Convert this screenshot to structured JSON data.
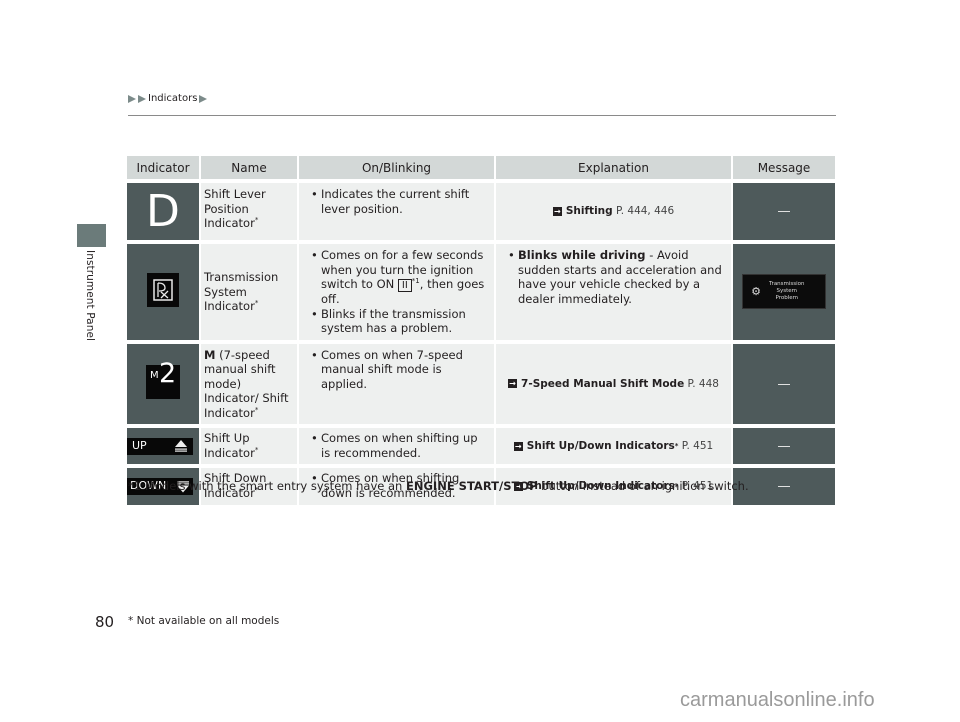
{
  "sidebar": {
    "section_label": "Instrument Panel",
    "tab_color": "#6b7b7a"
  },
  "breadcrumb": {
    "label": "Indicators"
  },
  "table": {
    "headers": [
      "Indicator",
      "Name",
      "On/Blinking",
      "Explanation",
      "Message"
    ],
    "rows": [
      {
        "indicator_icon": "shift-lever-d-icon",
        "indicator_glyph": "D",
        "name": "Shift Lever Position Indicator",
        "name_mark": "*",
        "on_blinking": [
          "Indicates the current shift lever position."
        ],
        "explanation": {
          "ref_title": "Shifting",
          "ref_page": "P. 444, 446"
        },
        "message": "—"
      },
      {
        "indicator_icon": "transmission-system-icon",
        "name": "Transmission System Indicator",
        "name_mark": "*",
        "on_blinking": [
          {
            "pre": "Comes on for a few seconds when you turn the ignition switch to ON ",
            "key": "II",
            "sup": "*1",
            "post": ", then goes off."
          },
          "Blinks if the transmission system has a problem."
        ],
        "explanation": {
          "bold": "Blinks while driving",
          "text": " - Avoid sudden starts and acceleration and have your vehicle checked by a dealer immediately."
        },
        "message": {
          "icon": "warning-gear-icon",
          "lines": [
            "Transmission",
            "System",
            "Problem"
          ]
        }
      },
      {
        "indicator_icon": "manual-mode-m2-icon",
        "indicator_glyph_small": "M",
        "indicator_glyph_big": "2",
        "name_bold": "M",
        "name": " (7-speed manual shift mode) Indicator/ Shift Indicator",
        "name_mark": "*",
        "on_blinking": [
          "Comes on when 7-speed manual shift mode is applied."
        ],
        "explanation": {
          "ref_title": "7-Speed Manual Shift Mode",
          "ref_page": "P. 448"
        },
        "message": "—"
      },
      {
        "indicator_icon": "shift-up-icon",
        "indicator_text": "UP",
        "name": "Shift Up Indicator",
        "name_mark": "*",
        "on_blinking": [
          "Comes on when shifting up is recommended."
        ],
        "explanation": {
          "ref_title": "Shift Up/Down Indicators",
          "ref_mark": "*",
          "ref_page": "P. 451"
        },
        "message": "—"
      },
      {
        "indicator_icon": "shift-down-icon",
        "indicator_text": "DOWN",
        "name": "Shift Down Indicator",
        "name_mark": "*",
        "on_blinking": [
          "Comes on when shifting down is recommended."
        ],
        "explanation": {
          "ref_title": "Shift Up/Down Indicators",
          "ref_mark": "*",
          "ref_page": "P. 451"
        },
        "message": "—"
      }
    ]
  },
  "footnote": {
    "prefix": "*1:Models with the smart entry system have an ",
    "bold": "ENGINE START/STOP",
    "suffix": " button instead of an ignition switch."
  },
  "page_number": "80",
  "availability_note": "* Not available on all models",
  "watermark": "carmanualsonline.info"
}
